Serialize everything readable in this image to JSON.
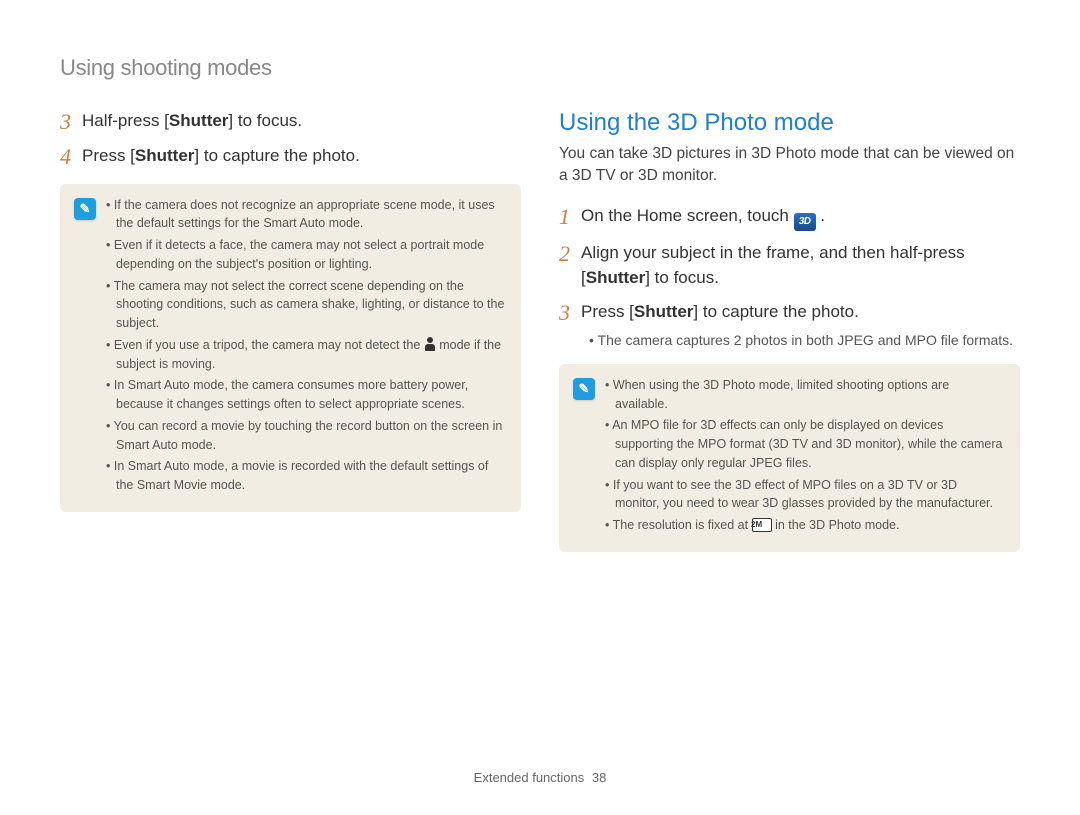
{
  "section_title": "Using shooting modes",
  "left": {
    "step3": {
      "num": "3",
      "pre": "Half-press [",
      "bold": "Shutter",
      "post": "] to focus."
    },
    "step4": {
      "num": "4",
      "pre": "Press [",
      "bold": "Shutter",
      "post": "] to capture the photo."
    },
    "notes": [
      "If the camera does not recognize an appropriate scene mode, it uses the default settings for the Smart Auto mode.",
      "Even if it detects a face, the camera may not select a portrait mode depending on the subject's position or lighting.",
      "The camera may not select the correct scene depending on the shooting conditions, such as camera shake, lighting, or distance to the subject.",
      "Even if you use a tripod, the camera may not detect the __PERSON__ mode if the subject is moving.",
      "In Smart Auto mode, the camera consumes more battery power, because it changes settings often to select appropriate scenes.",
      "You can record a movie by touching the record button on the screen in Smart Auto mode.",
      "In Smart Auto mode, a movie is recorded with the default settings of the Smart Movie mode."
    ]
  },
  "right": {
    "heading": "Using the 3D Photo mode",
    "intro": "You can take 3D pictures in 3D Photo mode that can be viewed on a 3D TV or 3D monitor.",
    "step1": {
      "num": "1",
      "text_pre": "On the Home screen, touch ",
      "icon_label": "3D"
    },
    "step2": {
      "num": "2",
      "line1": "Align your subject in the frame, and then half-press",
      "line2_pre": "[",
      "line2_bold": "Shutter",
      "line2_post": "] to focus."
    },
    "step3": {
      "num": "3",
      "pre": "Press [",
      "bold": "Shutter",
      "post": "] to capture the photo."
    },
    "step3_sub": "The camera captures 2 photos in both JPEG and MPO file formats.",
    "notes": [
      "When using the 3D Photo mode, limited shooting options are available.",
      "An MPO file for 3D effects can only be displayed on devices supporting the MPO format (3D TV and 3D monitor), while the camera can display only regular JPEG files.",
      "If you want to see the 3D effect of MPO files on a 3D TV or 3D monitor, you need to wear 3D glasses provided by the manufacturer.",
      "The resolution is fixed at __RES__ in the 3D Photo mode."
    ]
  },
  "footer": {
    "label": "Extended functions",
    "page": "38"
  }
}
